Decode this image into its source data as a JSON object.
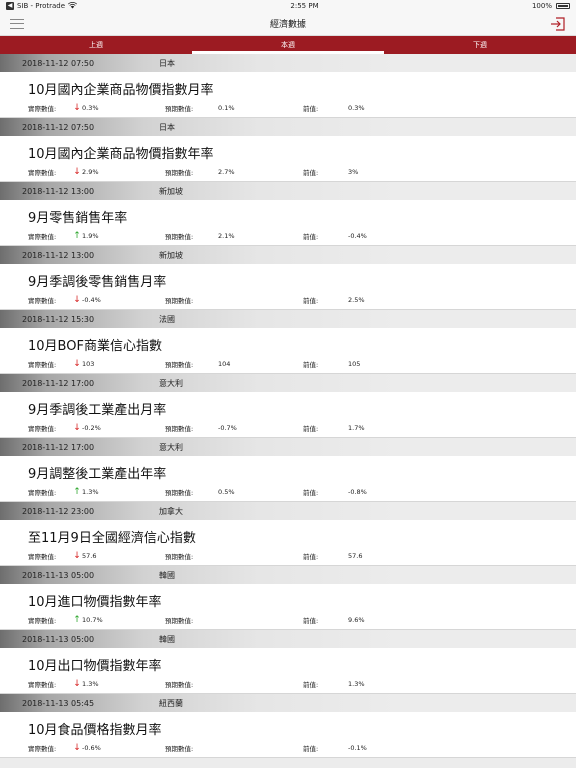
{
  "status": {
    "carrier": "SIB - Protrade",
    "time": "2:55 PM",
    "battery": "100%"
  },
  "nav": {
    "title": "經濟數據"
  },
  "tabs": [
    {
      "label": "上週",
      "active": false
    },
    {
      "label": "本週",
      "active": true
    },
    {
      "label": "下週",
      "active": false
    }
  ],
  "labels": {
    "actual": "實際數值:",
    "forecast": "預期數值:",
    "previous": "前值:"
  },
  "items": [
    {
      "time": "2018-11-12 07:50",
      "country": "日本",
      "title": "10月國內企業商品物價指數月率",
      "actual": "0.3%",
      "trend": "down",
      "forecast": "0.1%",
      "previous": "0.3%"
    },
    {
      "time": "2018-11-12 07:50",
      "country": "日本",
      "title": "10月國內企業商品物價指數年率",
      "actual": "2.9%",
      "trend": "down",
      "forecast": "2.7%",
      "previous": "3%"
    },
    {
      "time": "2018-11-12 13:00",
      "country": "新加坡",
      "title": "9月零售銷售年率",
      "actual": "1.9%",
      "trend": "up",
      "forecast": "2.1%",
      "previous": "-0.4%"
    },
    {
      "time": "2018-11-12 13:00",
      "country": "新加坡",
      "title": "9月季調後零售銷售月率",
      "actual": "-0.4%",
      "trend": "down",
      "forecast": "",
      "previous": "2.5%"
    },
    {
      "time": "2018-11-12 15:30",
      "country": "法國",
      "title": "10月BOF商業信心指數",
      "actual": "103",
      "trend": "down",
      "forecast": "104",
      "previous": "105"
    },
    {
      "time": "2018-11-12 17:00",
      "country": "意大利",
      "title": "9月季調後工業產出月率",
      "actual": "-0.2%",
      "trend": "down",
      "forecast": "-0.7%",
      "previous": "1.7%"
    },
    {
      "time": "2018-11-12 17:00",
      "country": "意大利",
      "title": "9月調整後工業產出年率",
      "actual": "1.3%",
      "trend": "up",
      "forecast": "0.5%",
      "previous": "-0.8%"
    },
    {
      "time": "2018-11-12 23:00",
      "country": "加拿大",
      "title": "至11月9日全國經濟信心指數",
      "actual": "57.6",
      "trend": "down",
      "forecast": "",
      "previous": "57.6"
    },
    {
      "time": "2018-11-13 05:00",
      "country": "韓國",
      "title": "10月進口物價指數年率",
      "actual": "10.7%",
      "trend": "up",
      "forecast": "",
      "previous": "9.6%"
    },
    {
      "time": "2018-11-13 05:00",
      "country": "韓國",
      "title": "10月出口物價指數年率",
      "actual": "1.3%",
      "trend": "down",
      "forecast": "",
      "previous": "1.3%"
    },
    {
      "time": "2018-11-13 05:45",
      "country": "紐西蘭",
      "title": "10月食品價格指數月率",
      "actual": "-0.6%",
      "trend": "down",
      "forecast": "",
      "previous": "-0.1%"
    }
  ],
  "colors": {
    "accent": "#9c1b22",
    "down": "#d62020",
    "up": "#2aa52a"
  }
}
